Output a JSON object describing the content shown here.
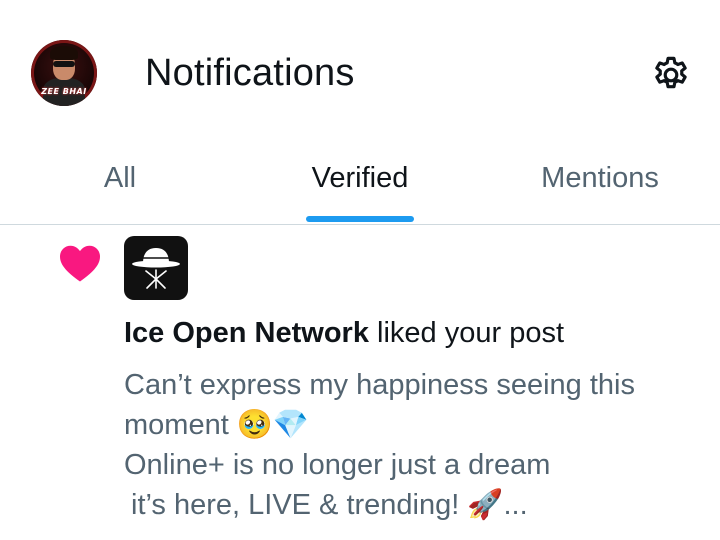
{
  "header": {
    "title": "Notifications",
    "avatar_brand": "ZEE BHAI",
    "settings_icon": "gear-icon"
  },
  "tabs": [
    {
      "label": "All",
      "active": false
    },
    {
      "label": "Verified",
      "active": true
    },
    {
      "label": "Mentions",
      "active": false
    }
  ],
  "notification": {
    "type_icon": "heart-icon",
    "actor": "Ice Open Network",
    "action": " liked your post",
    "post_lines": [
      "Can’t express my happiness seeing this",
      "moment 🥹💎",
      "Online+ is no longer just a dream",
      "it’s here, LIVE & trending! 🚀..."
    ]
  },
  "colors": {
    "accent": "#1d9bf0",
    "heart": "#f91880",
    "text_primary": "#0f1419",
    "text_secondary": "#536471"
  }
}
